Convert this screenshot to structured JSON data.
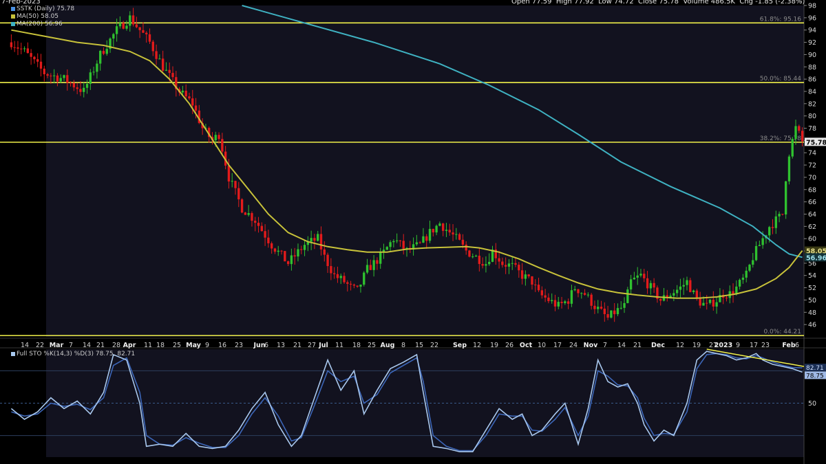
{
  "header": {
    "date": "7-Feb-2023",
    "open_label": "Open",
    "open": "77.59",
    "high_label": "High",
    "high": "77.92",
    "low_label": "Low",
    "low": "74.72",
    "close_label": "Close",
    "close": "75.78",
    "volume_label": "Volume",
    "volume": "486.5K",
    "chg_label": "Chg",
    "chg": "-1.85 (-2.38%)"
  },
  "legend": {
    "price": "SSTK (Daily) 75.78",
    "ma50": "MA(50) 58.05",
    "ma200": "MA(200) 56.96"
  },
  "colors": {
    "up": "#2fc12f",
    "down": "#e31b1b",
    "ma50": "#c8c23a",
    "ma200": "#3fb2c2",
    "hline": "#f2f24a",
    "sto_k": "#a9c8ee",
    "sto_d": "#3c66b8"
  },
  "chart_data": [
    {
      "type": "candlestick",
      "title": "SSTK (Daily)",
      "ylim": [
        44,
        98
      ],
      "y_ticks": [
        46,
        48,
        50,
        52,
        54,
        56,
        58,
        60,
        62,
        64,
        66,
        68,
        70,
        72,
        74,
        76,
        78,
        80,
        82,
        84,
        86,
        88,
        90,
        92,
        94,
        96,
        98
      ],
      "x_tick_labels": [
        "14",
        "22",
        "Mar",
        "7",
        "14",
        "21",
        "28",
        "Apr",
        "11",
        "18",
        "25",
        "May",
        "9",
        "16",
        "23",
        "Jun",
        "6",
        "13",
        "21",
        "27",
        "Jul",
        "11",
        "18",
        "25",
        "Aug",
        "8",
        "15",
        "22",
        "Sep",
        "12",
        "19",
        "26",
        "Oct",
        "10",
        "17",
        "24",
        "Nov",
        "7",
        "14",
        "21",
        "Dec",
        "12",
        "19",
        "27",
        "2023",
        "9",
        "17",
        "23",
        "Feb",
        "6"
      ],
      "price_points": [
        [
          0,
          92
        ],
        [
          4,
          90.5
        ],
        [
          10,
          87
        ],
        [
          16,
          86
        ],
        [
          22,
          84
        ],
        [
          27,
          90
        ],
        [
          32,
          94
        ],
        [
          36,
          96
        ],
        [
          42,
          92
        ],
        [
          46,
          88
        ],
        [
          51,
          84
        ],
        [
          55,
          82
        ],
        [
          58,
          78
        ],
        [
          61,
          76
        ],
        [
          63,
          77
        ],
        [
          66,
          70
        ],
        [
          70,
          65
        ],
        [
          74,
          63
        ],
        [
          79,
          59
        ],
        [
          84,
          56
        ],
        [
          89,
          59
        ],
        [
          93,
          60
        ],
        [
          95,
          57
        ],
        [
          98,
          54
        ],
        [
          101,
          53
        ],
        [
          103,
          52
        ],
        [
          105,
          51.5
        ],
        [
          108,
          55
        ],
        [
          112,
          57
        ],
        [
          116,
          60
        ],
        [
          120,
          58
        ],
        [
          124,
          59
        ],
        [
          127,
          61
        ],
        [
          130,
          62.5
        ],
        [
          133,
          61
        ],
        [
          135,
          60
        ],
        [
          138,
          58
        ],
        [
          141,
          57
        ],
        [
          144,
          56
        ],
        [
          146,
          58
        ],
        [
          149,
          56
        ],
        [
          152,
          55.5
        ],
        [
          155,
          54
        ],
        [
          158,
          53
        ],
        [
          160,
          51
        ],
        [
          163,
          50
        ],
        [
          166,
          49
        ],
        [
          169,
          50
        ],
        [
          171,
          52
        ],
        [
          174,
          51
        ],
        [
          177,
          49
        ],
        [
          179,
          48
        ],
        [
          181,
          47
        ],
        [
          183,
          48
        ],
        [
          186,
          49
        ],
        [
          188,
          53
        ],
        [
          191,
          54
        ],
        [
          194,
          52
        ],
        [
          197,
          50
        ],
        [
          200,
          51
        ],
        [
          203,
          52
        ],
        [
          205,
          53
        ],
        [
          208,
          50
        ],
        [
          211,
          49
        ],
        [
          214,
          50
        ],
        [
          216,
          51
        ],
        [
          218,
          51
        ],
        [
          220,
          52
        ],
        [
          223,
          54
        ],
        [
          225,
          57
        ],
        [
          228,
          60
        ],
        [
          230,
          62
        ],
        [
          232,
          63
        ],
        [
          234,
          64
        ],
        [
          235,
          70
        ],
        [
          236,
          74
        ],
        [
          237,
          76
        ],
        [
          238,
          78
        ],
        [
          239,
          77
        ],
        [
          240,
          75.8
        ]
      ],
      "series": [
        {
          "name": "MA(50)",
          "last": 58.05,
          "points": [
            [
              0,
              94
            ],
            [
              10,
              93
            ],
            [
              20,
              92
            ],
            [
              28,
              91.5
            ],
            [
              36,
              90.5
            ],
            [
              42,
              89
            ],
            [
              48,
              86
            ],
            [
              54,
              82
            ],
            [
              60,
              77
            ],
            [
              66,
              72
            ],
            [
              72,
              68
            ],
            [
              78,
              64
            ],
            [
              84,
              61
            ],
            [
              90,
              59.5
            ],
            [
              96,
              58.7
            ],
            [
              102,
              58.2
            ],
            [
              108,
              57.8
            ],
            [
              114,
              57.8
            ],
            [
              120,
              58.3
            ],
            [
              126,
              58.5
            ],
            [
              132,
              58.6
            ],
            [
              138,
              58.7
            ],
            [
              142,
              58.5
            ],
            [
              148,
              57.8
            ],
            [
              154,
              56.7
            ],
            [
              160,
              55.3
            ],
            [
              166,
              54
            ],
            [
              172,
              52.8
            ],
            [
              178,
              51.8
            ],
            [
              184,
              51.2
            ],
            [
              190,
              50.8
            ],
            [
              196,
              50.5
            ],
            [
              202,
              50.3
            ],
            [
              208,
              50.3
            ],
            [
              214,
              50.5
            ],
            [
              220,
              51
            ],
            [
              226,
              51.8
            ],
            [
              232,
              53.5
            ],
            [
              236,
              55.3
            ],
            [
              240,
              58.05
            ]
          ]
        },
        {
          "name": "MA(200)",
          "last": 56.96,
          "points": [
            [
              70,
              98
            ],
            [
              90,
              95
            ],
            [
              110,
              92
            ],
            [
              130,
              88.5
            ],
            [
              145,
              85
            ],
            [
              160,
              81
            ],
            [
              172,
              77
            ],
            [
              185,
              72.5
            ],
            [
              200,
              68.5
            ],
            [
              215,
              65
            ],
            [
              225,
              62
            ],
            [
              232,
              59
            ],
            [
              236,
              57.5
            ],
            [
              240,
              56.96
            ]
          ]
        }
      ],
      "horizontal_lines": [
        {
          "label": "61.8%: 95.16",
          "value": 95.16
        },
        {
          "label": "50.0%: 85.44",
          "value": 85.44
        },
        {
          "label": "38.2%: 75.78",
          "value": 75.72
        },
        {
          "label": "0.0%: 44.21",
          "value": 44.21
        }
      ],
      "last_price_tag": "75.78",
      "ma50_tag": "58.05",
      "ma200_tag": "56.96"
    },
    {
      "type": "line",
      "title": "Full STO %K(14,3) %D(3) 78.75, 82.71",
      "ylim": [
        0,
        100
      ],
      "y_ticks": [
        50
      ],
      "level_lines": [
        80,
        50,
        20
      ],
      "series": [
        {
          "name": "%K",
          "last": 78.75,
          "points": [
            [
              0,
              45
            ],
            [
              4,
              35
            ],
            [
              8,
              42
            ],
            [
              12,
              55
            ],
            [
              16,
              45
            ],
            [
              20,
              52
            ],
            [
              24,
              40
            ],
            [
              28,
              60
            ],
            [
              31,
              95
            ],
            [
              35,
              90
            ],
            [
              39,
              50
            ],
            [
              41,
              10
            ],
            [
              45,
              12
            ],
            [
              49,
              10
            ],
            [
              53,
              22
            ],
            [
              57,
              10
            ],
            [
              61,
              8
            ],
            [
              65,
              10
            ],
            [
              69,
              25
            ],
            [
              73,
              45
            ],
            [
              77,
              60
            ],
            [
              81,
              30
            ],
            [
              85,
              10
            ],
            [
              88,
              20
            ],
            [
              92,
              55
            ],
            [
              96,
              90
            ],
            [
              100,
              62
            ],
            [
              104,
              80
            ],
            [
              107,
              40
            ],
            [
              111,
              62
            ],
            [
              115,
              82
            ],
            [
              119,
              88
            ],
            [
              123,
              95
            ],
            [
              125,
              60
            ],
            [
              128,
              10
            ],
            [
              132,
              8
            ],
            [
              136,
              5
            ],
            [
              140,
              5
            ],
            [
              144,
              25
            ],
            [
              148,
              45
            ],
            [
              152,
              35
            ],
            [
              155,
              40
            ],
            [
              158,
              20
            ],
            [
              161,
              25
            ],
            [
              165,
              40
            ],
            [
              168,
              50
            ],
            [
              172,
              12
            ],
            [
              175,
              45
            ],
            [
              178,
              90
            ],
            [
              181,
              70
            ],
            [
              184,
              65
            ],
            [
              187,
              68
            ],
            [
              190,
              50
            ],
            [
              192,
              30
            ],
            [
              195,
              15
            ],
            [
              198,
              25
            ],
            [
              201,
              20
            ],
            [
              205,
              50
            ],
            [
              208,
              90
            ],
            [
              211,
              98
            ],
            [
              214,
              96
            ],
            [
              217,
              94
            ],
            [
              220,
              90
            ],
            [
              223,
              92
            ],
            [
              226,
              96
            ],
            [
              228,
              90
            ],
            [
              231,
              86
            ],
            [
              234,
              84
            ],
            [
              237,
              82
            ],
            [
              240,
              78.75
            ]
          ]
        },
        {
          "name": "%D",
          "last": 82.71,
          "points": [
            [
              0,
              42
            ],
            [
              4,
              38
            ],
            [
              8,
              40
            ],
            [
              12,
              50
            ],
            [
              16,
              47
            ],
            [
              20,
              49
            ],
            [
              24,
              44
            ],
            [
              28,
              55
            ],
            [
              31,
              85
            ],
            [
              35,
              92
            ],
            [
              39,
              60
            ],
            [
              41,
              20
            ],
            [
              45,
              12
            ],
            [
              49,
              11
            ],
            [
              53,
              18
            ],
            [
              57,
              13
            ],
            [
              61,
              9
            ],
            [
              65,
              9
            ],
            [
              69,
              20
            ],
            [
              73,
              40
            ],
            [
              77,
              55
            ],
            [
              81,
              38
            ],
            [
              85,
              15
            ],
            [
              88,
              18
            ],
            [
              92,
              48
            ],
            [
              96,
              80
            ],
            [
              100,
              70
            ],
            [
              104,
              75
            ],
            [
              107,
              50
            ],
            [
              111,
              58
            ],
            [
              115,
              78
            ],
            [
              119,
              85
            ],
            [
              123,
              92
            ],
            [
              125,
              70
            ],
            [
              128,
              20
            ],
            [
              132,
              10
            ],
            [
              136,
              6
            ],
            [
              140,
              6
            ],
            [
              144,
              20
            ],
            [
              148,
              40
            ],
            [
              152,
              38
            ],
            [
              155,
              38
            ],
            [
              158,
              25
            ],
            [
              161,
              24
            ],
            [
              165,
              35
            ],
            [
              168,
              46
            ],
            [
              172,
              20
            ],
            [
              175,
              38
            ],
            [
              178,
              80
            ],
            [
              181,
              75
            ],
            [
              184,
              67
            ],
            [
              187,
              66
            ],
            [
              190,
              55
            ],
            [
              192,
              36
            ],
            [
              195,
              20
            ],
            [
              198,
              22
            ],
            [
              201,
              21
            ],
            [
              205,
              42
            ],
            [
              208,
              82
            ],
            [
              211,
              95
            ],
            [
              214,
              96
            ],
            [
              217,
              95
            ],
            [
              220,
              92
            ],
            [
              223,
              91
            ],
            [
              226,
              94
            ],
            [
              228,
              92
            ],
            [
              231,
              88
            ],
            [
              234,
              85
            ],
            [
              237,
              83
            ],
            [
              240,
              82.71
            ]
          ]
        }
      ],
      "sto_tags": [
        "82.71",
        "78.75"
      ]
    }
  ]
}
